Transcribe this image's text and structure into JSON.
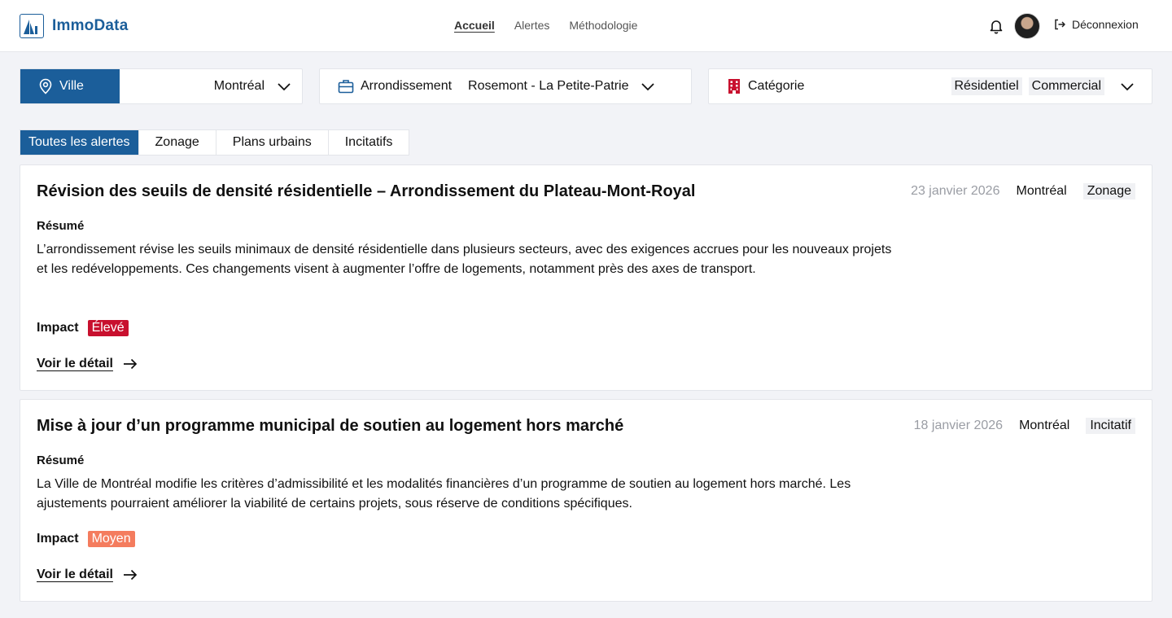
{
  "brand": {
    "name": "ImmoData"
  },
  "nav": {
    "items": [
      "Accueil",
      "Alertes",
      "Méthodologie"
    ]
  },
  "header": {
    "logout_label": "Déconnexion"
  },
  "filters": {
    "city": {
      "label": "Ville",
      "value": "Montréal"
    },
    "borough": {
      "label": "Arrondissement",
      "value": "Rosemont - La Petite-Patrie"
    },
    "category": {
      "label": "Catégorie",
      "values": [
        "Résidentiel",
        "Commercial"
      ]
    }
  },
  "tabs": [
    "Toutes les alertes",
    "Zonage",
    "Plans urbains",
    "Incitatifs"
  ],
  "alerts": [
    {
      "title": "Révision des seuils de densité résidentielle – Arrondissement du Plateau-Mont-Royal",
      "date": "23 janvier 2026",
      "city": "Montréal",
      "tag": "Zonage",
      "summary_heading": "Résumé",
      "summary": "L’arrondissement révise les seuils minimaux de densité résidentielle dans plusieurs secteurs, avec des exigences accrues pour les nouveaux projets et les redéveloppements. Ces changements visent à augmenter l’offre de logements, notamment près des axes de transport.",
      "impact_label": "Impact",
      "impact": "Élevé",
      "link": "Voir le détail"
    },
    {
      "title": "Mise à jour d’un programme municipal de soutien au logement hors marché",
      "date": "18 janvier 2026",
      "city": "Montréal",
      "tag": "Incitatif",
      "summary_heading": "Résumé",
      "summary": "La Ville de Montréal modifie les critères d’admissibilité et les modalités financières d’un programme de soutien au logement hors marché. Les ajustements pourraient améliorer la viabilité de certains projets, sous réserve de conditions spécifiques.",
      "impact_label": "Impact",
      "impact": "Moyen",
      "link": "Voir le détail"
    }
  ],
  "colors": {
    "brand": "#1b5e9a",
    "impact_high": "#c8102e",
    "impact_medium": "#f47c5e"
  }
}
